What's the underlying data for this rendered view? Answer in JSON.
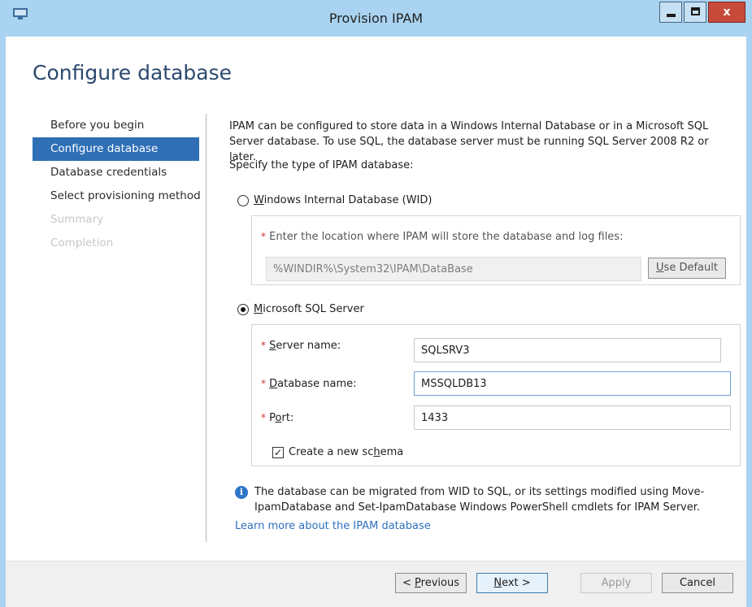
{
  "window": {
    "title": "Provision IPAM",
    "close_glyph": "x"
  },
  "page": {
    "title": "Configure database"
  },
  "nav": {
    "items": [
      {
        "label": "Before you begin",
        "state": "normal"
      },
      {
        "label": "Configure database",
        "state": "active"
      },
      {
        "label": "Database credentials",
        "state": "normal"
      },
      {
        "label": "Select provisioning method",
        "state": "normal"
      },
      {
        "label": "Summary",
        "state": "disabled"
      },
      {
        "label": "Completion",
        "state": "disabled"
      }
    ]
  },
  "content": {
    "intro": "IPAM can be configured to store data in a Windows Internal Database or in a Microsoft SQL Server database. To use SQL, the database server must be running SQL Server 2008 R2 or later.",
    "spec_label": "Specify the type of IPAM database:",
    "wid": {
      "label_first": "W",
      "label_rest": "indows Internal Database (WID)",
      "selected": false,
      "location_label": "Enter the location where IPAM will store the database and log files:",
      "location_value": "%WINDIR%\\System32\\IPAM\\DataBase",
      "use_default_first": "U",
      "use_default_rest": "se Default"
    },
    "sql": {
      "label_first": "M",
      "label_rest": "icrosoft SQL Server",
      "selected": true,
      "server_label_first": "S",
      "server_label_rest": "erver name:",
      "server_value": "SQLSRV3",
      "db_label_first": "D",
      "db_label_rest": "atabase name:",
      "db_value": "MSSQLDB13",
      "port_label_first": "P",
      "port_label_o": "o",
      "port_label_rest": "rt:",
      "port_value": "1433",
      "schema_label_a": "Create a new sc",
      "schema_label_u": "h",
      "schema_label_b": "ema",
      "schema_checked": true,
      "required_mark": "*"
    },
    "info": "The database can be migrated from WID to SQL, or its settings modified using Move-IpamDatabase and Set-IpamDatabase Windows PowerShell cmdlets for IPAM Server.",
    "info_icon_glyph": "i",
    "learn_more": "Learn more about the IPAM database"
  },
  "footer": {
    "previous_pre": "< ",
    "previous_u": "P",
    "previous_rest": "revious",
    "next_u": "N",
    "next_rest": "ext >",
    "apply": "Apply",
    "cancel": "Cancel"
  },
  "colors": {
    "title_bar": "#a9d3f0",
    "accent": "#2e6fb6",
    "required": "#d0352d",
    "link": "#2f6fbe"
  }
}
